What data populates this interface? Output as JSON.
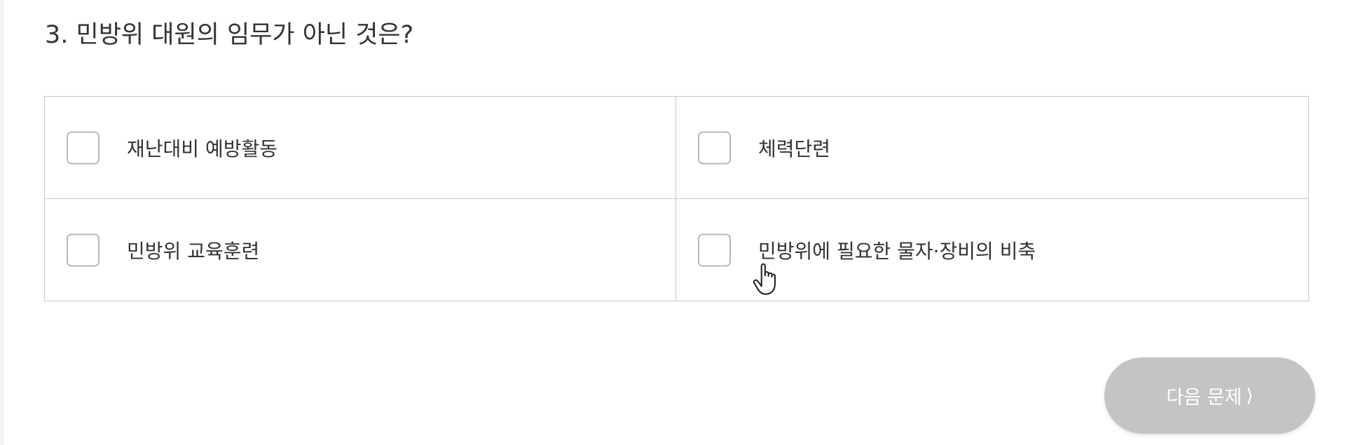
{
  "question": {
    "text": "3. 민방위 대원의 임무가 아닌 것은?"
  },
  "options": [
    {
      "label": "재난대비 예방활동"
    },
    {
      "label": "체력단련"
    },
    {
      "label": "민방위 교육훈련"
    },
    {
      "label": "민방위에 필요한 물자·장비의 비축"
    }
  ],
  "next_button": {
    "label": "다음 문제",
    "icon": "chevron-right-icon"
  },
  "colors": {
    "text": "#333333",
    "border": "#c9c9c9",
    "checkbox_border": "#b8b8b8",
    "button_bg": "#c4c4c4",
    "button_text": "#ffffff"
  }
}
